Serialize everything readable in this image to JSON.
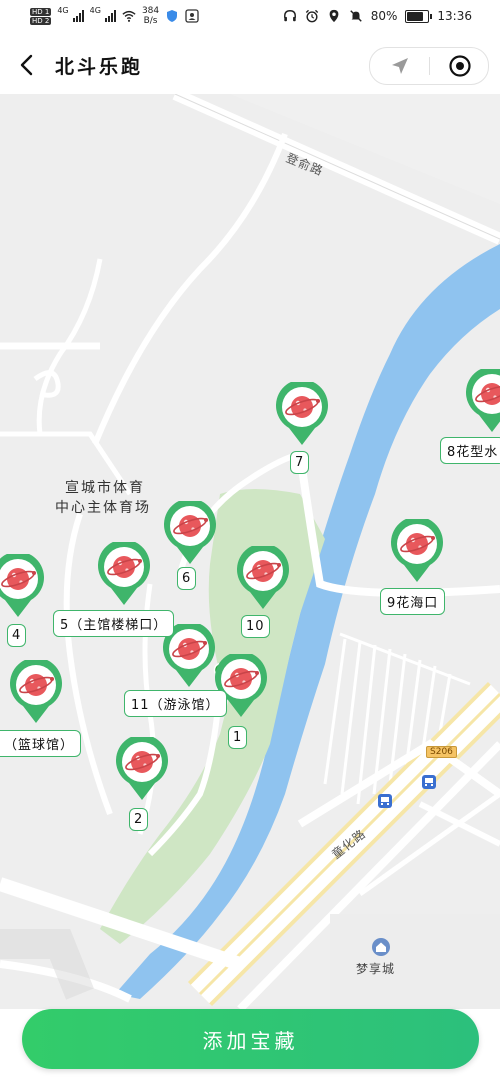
{
  "status_bar": {
    "hd1": "HD 1",
    "hd2": "HD 2",
    "sig1": "4G",
    "sig2": "4G",
    "net_speed_value": "384",
    "net_speed_unit": "B/s",
    "battery_percent": "80%",
    "battery_level": 0.8,
    "time": "13:36"
  },
  "navbar": {
    "title": "北斗乐跑"
  },
  "map": {
    "place_label_line1": "宣城市体育",
    "place_label_line2": "中心主体育场",
    "road_top": "登俞路",
    "road_bottom": "童化路",
    "road_badge": "S206",
    "poi_bottom": "梦享城",
    "markers": [
      {
        "id": "7",
        "label": "7"
      },
      {
        "id": "8",
        "label": "8花型水"
      },
      {
        "id": "6",
        "label": "6"
      },
      {
        "id": "9",
        "label": "9花海口"
      },
      {
        "id": "10",
        "label": "10"
      },
      {
        "id": "5",
        "label": "5（主馆楼梯口）"
      },
      {
        "id": "4",
        "label": "4"
      },
      {
        "id": "11",
        "label": "11（游泳馆）"
      },
      {
        "id": "1",
        "label": "1"
      },
      {
        "id": "3",
        "label": "（篮球馆）"
      },
      {
        "id": "2",
        "label": "2"
      }
    ]
  },
  "bottom": {
    "add_button_label": "添加宝藏"
  },
  "colors": {
    "accent_green": "#3fb56b",
    "button_green": "#33cc6a",
    "water_blue": "#8fc3ef",
    "park_green": "#cfe6c4",
    "marker_red": "#e8585c"
  }
}
